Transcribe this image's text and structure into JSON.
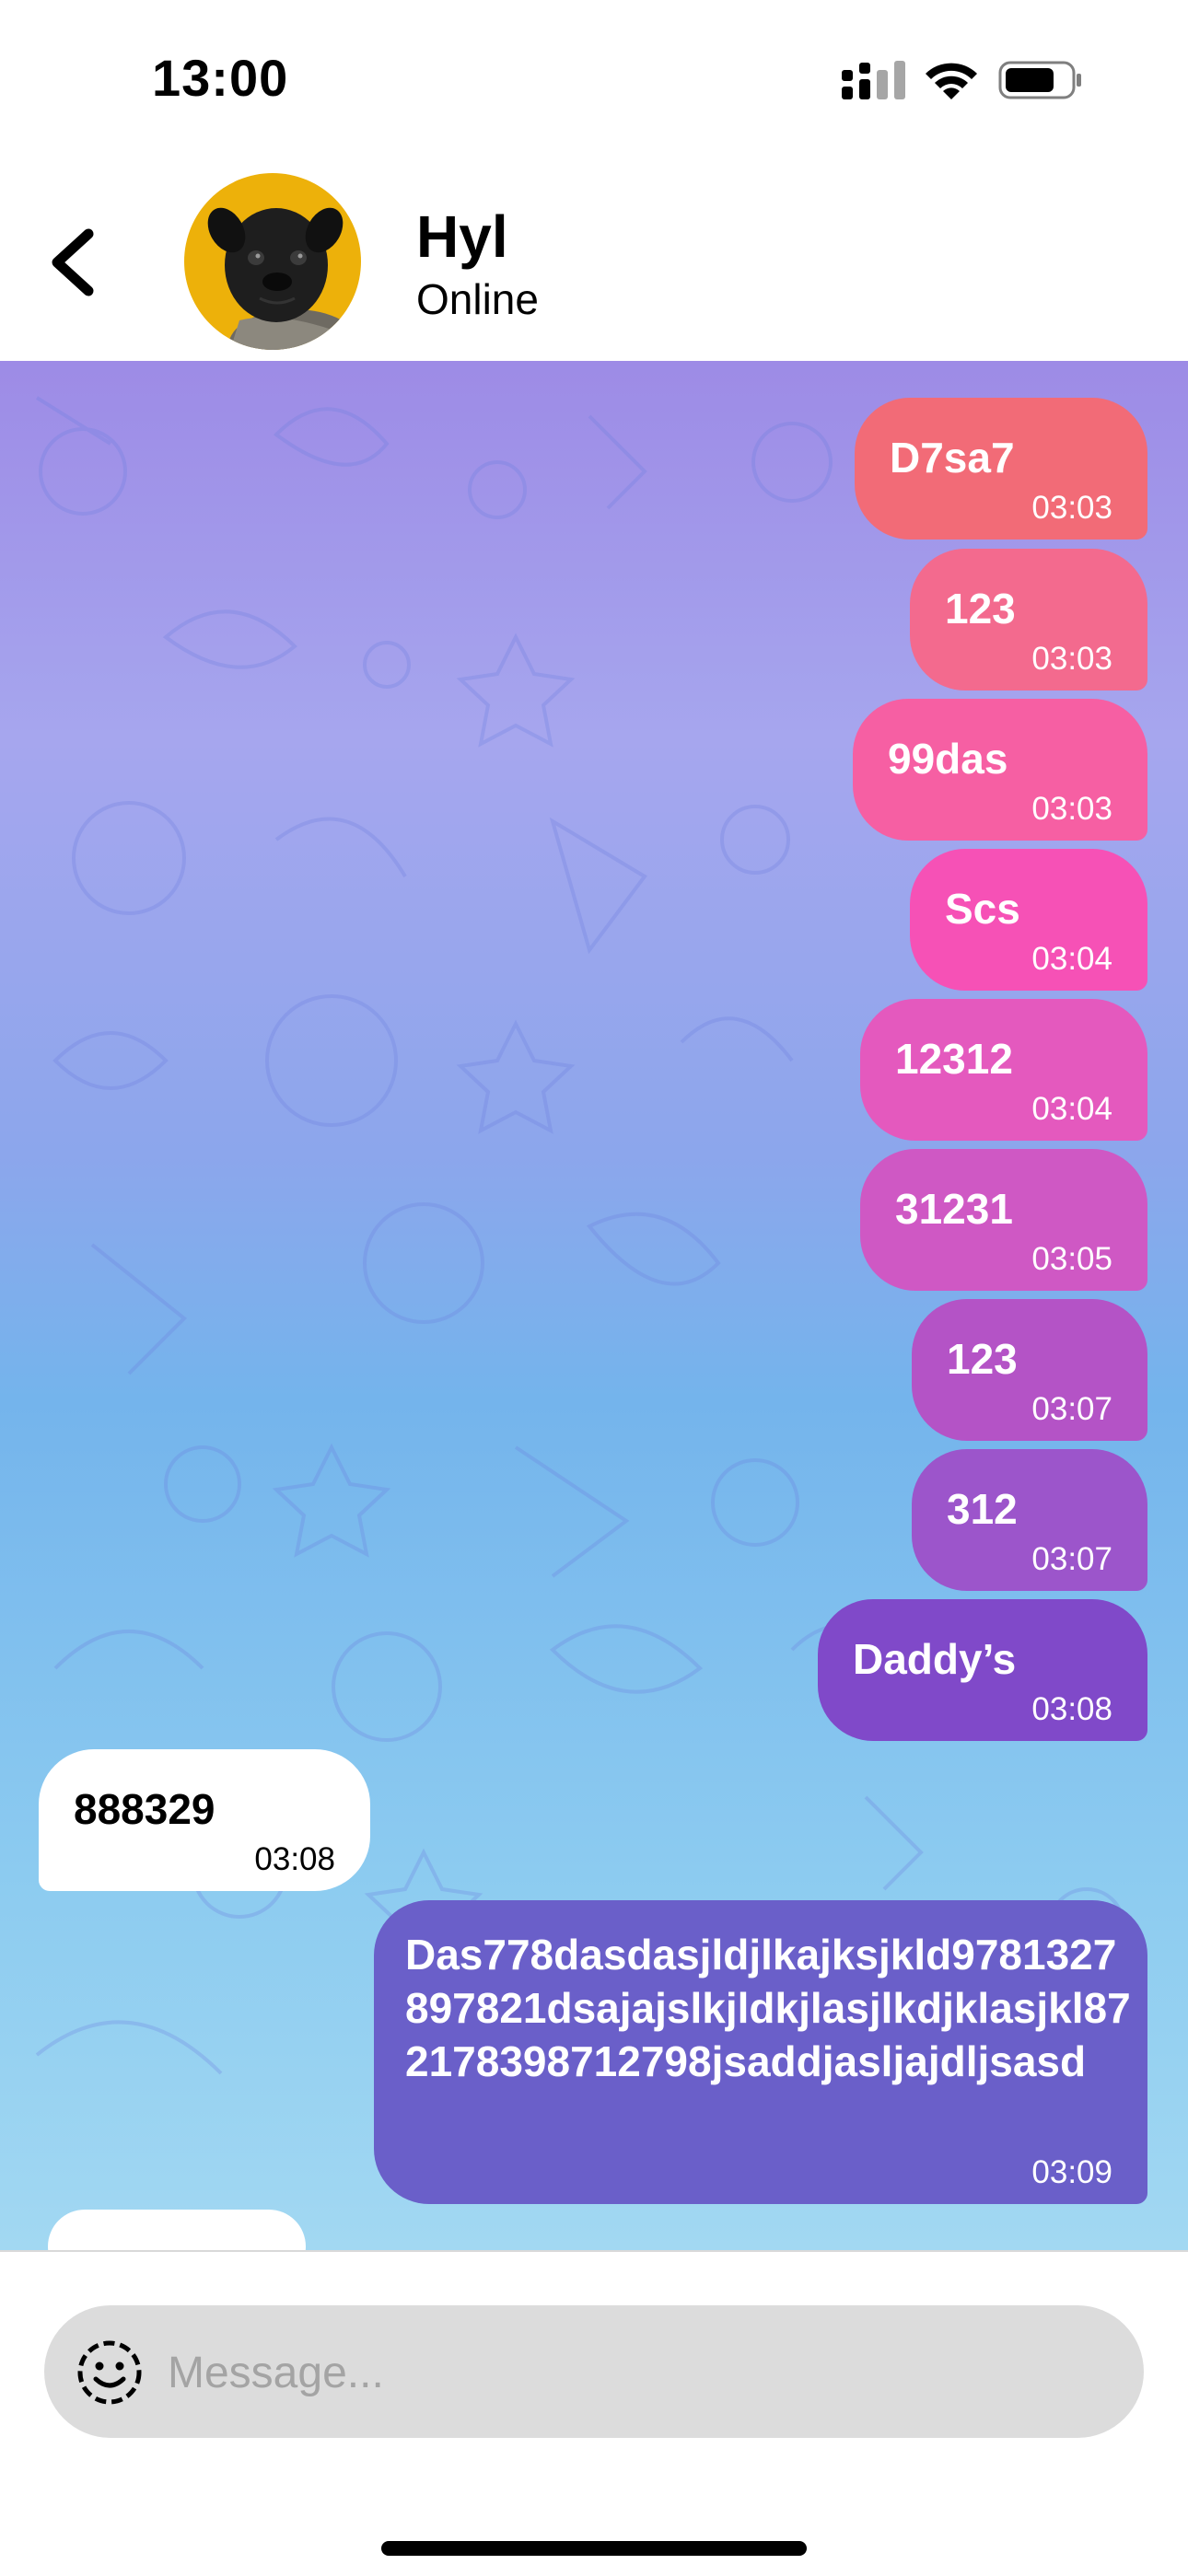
{
  "status_bar": {
    "time": "13:00",
    "icons": [
      "signal-icon",
      "wifi-icon",
      "battery-icon"
    ]
  },
  "header": {
    "contact_name": "Hyl",
    "contact_status": "Online",
    "back_icon": "chevron-left-icon",
    "avatar_background": "#EDB10A"
  },
  "messages": [
    {
      "direction": "out",
      "text": "D7sa7",
      "time": "03:03",
      "color": "#F26B77"
    },
    {
      "direction": "out",
      "text": "123",
      "time": "03:03",
      "color": "#F36A8E"
    },
    {
      "direction": "out",
      "text": "99das",
      "time": "03:03",
      "color": "#F65FA3"
    },
    {
      "direction": "out",
      "text": "Scs",
      "time": "03:04",
      "color": "#F651B6"
    },
    {
      "direction": "out",
      "text": "12312",
      "time": "03:04",
      "color": "#E459BE"
    },
    {
      "direction": "out",
      "text": "31231",
      "time": "03:05",
      "color": "#CF58C4"
    },
    {
      "direction": "out",
      "text": "123",
      "time": "03:07",
      "color": "#B453C6"
    },
    {
      "direction": "out",
      "text": "312",
      "time": "03:07",
      "color": "#9C55CB"
    },
    {
      "direction": "out",
      "text": "Daddy’s",
      "time": "03:08",
      "color": "#8049C9"
    },
    {
      "direction": "in",
      "text": "888329",
      "time": "03:08",
      "color": "#FFFFFF"
    },
    {
      "direction": "out",
      "text": "Das778dasdasjldjlkajksjkld9781327897821dsajajslkjldkjlasjlkdjklasjkl872178398712798jsaddjasljajdljsasd",
      "time": "03:09",
      "color": "#6A5FC9"
    }
  ],
  "composer": {
    "placeholder": "Message...",
    "emoji_icon": "emoji-icon"
  }
}
